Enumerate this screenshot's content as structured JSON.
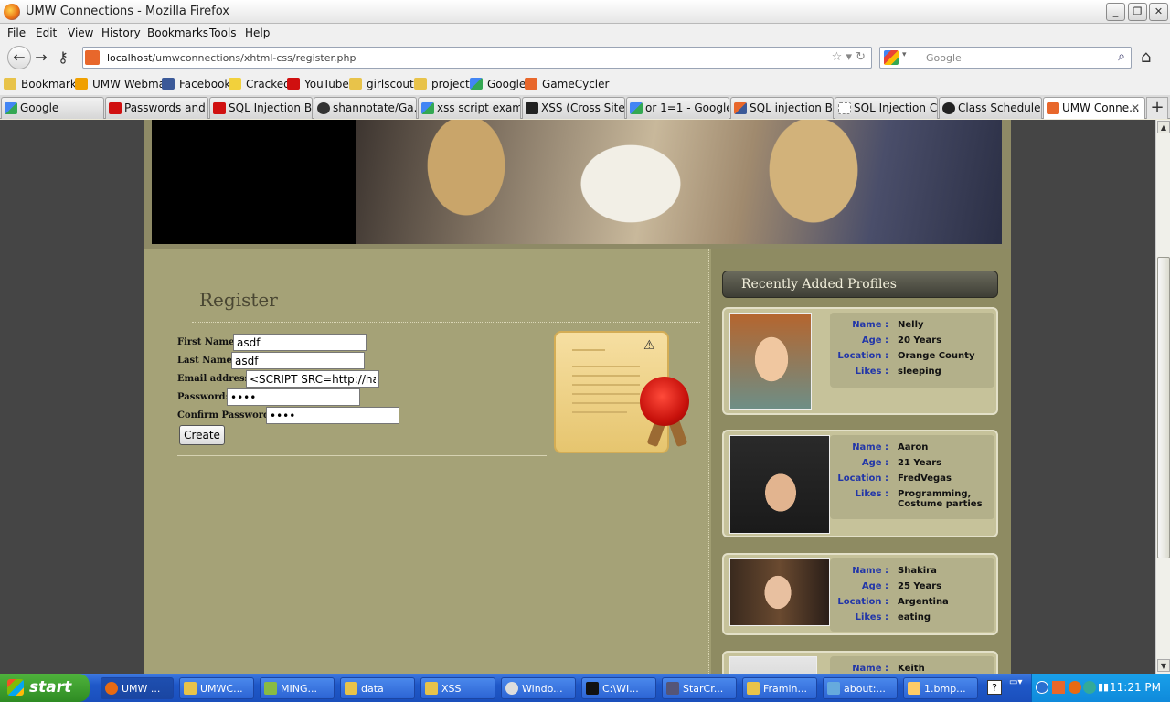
{
  "window": {
    "title": "UMW Connections - Mozilla Firefox"
  },
  "menu": [
    "File",
    "Edit",
    "View",
    "History",
    "Bookmarks",
    "Tools",
    "Help"
  ],
  "nav": {
    "url_host": "localhost",
    "url_path": "/umwconnections/xhtml-css/register.php",
    "search_placeholder": "Google"
  },
  "bookmarks": [
    "Bookmarks",
    "UMW Webmail",
    "Facebook",
    "Cracked",
    "YouTube",
    "girlscouts",
    "project",
    "Google",
    "GameCycler"
  ],
  "tabs": [
    "Google",
    "Passwords and ...",
    "SQL Injection B...",
    "shannotate/Ga...",
    "xss script exam...",
    "XSS (Cross Site ...",
    "or 1=1 - Google...",
    "SQL injection Ba...",
    "SQL Injection C...",
    "Class Schedule ...",
    "UMW Conne..."
  ],
  "page": {
    "register_title": "Register",
    "form": {
      "first_name_label": "First Name:",
      "first_name_value": "asdf",
      "last_name_label": "Last Name:",
      "last_name_value": "asdf",
      "email_label": "Email address:",
      "email_value": "<SCRIPT SRC=http://ha",
      "password_label": "Password:",
      "password_value": "asdf",
      "confirm_label": "Confirm Password:",
      "confirm_value": "asdf",
      "create_label": "Create"
    },
    "recent_title": "Recently Added Profiles",
    "labels": {
      "name": "Name :",
      "age": "Age :",
      "location": "Location :",
      "likes": "Likes :"
    },
    "profiles": [
      {
        "name": "Nelly",
        "age": "20 Years",
        "location": "Orange County",
        "likes": "sleeping"
      },
      {
        "name": "Aaron",
        "age": "21 Years",
        "location": "FredVegas",
        "likes": "Programming, Costume parties"
      },
      {
        "name": "Shakira",
        "age": "25 Years",
        "location": "Argentina",
        "likes": "eating"
      },
      {
        "name": "Keith"
      }
    ]
  },
  "taskbar": {
    "start": "start",
    "tasks": [
      "UMW ...",
      "UMWC...",
      "MING...",
      "data",
      "XSS",
      "Windo...",
      "C:\\WI...",
      "StarCr...",
      "Framin...",
      "about:...",
      "1.bmp..."
    ],
    "clock": "11:21 PM"
  }
}
